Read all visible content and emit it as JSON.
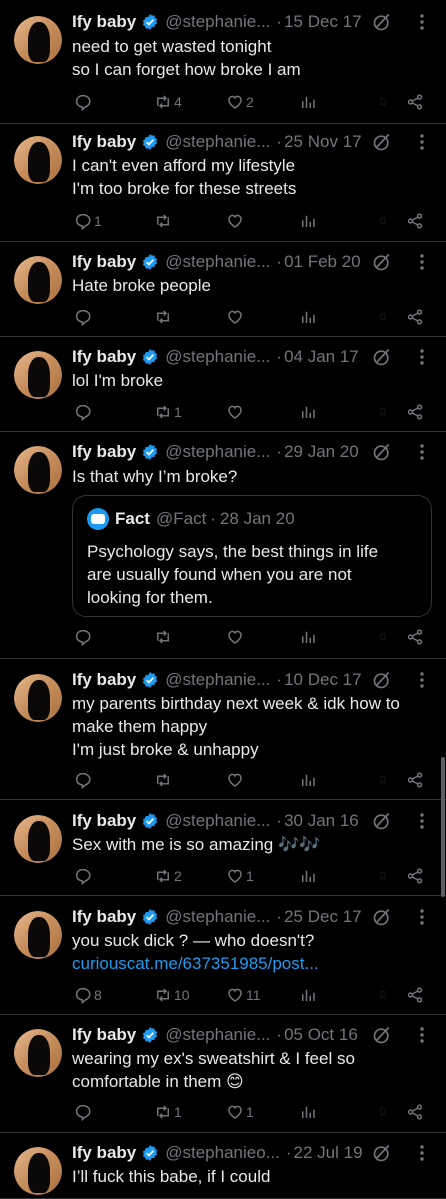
{
  "tweets": [
    {
      "name": "Ify baby",
      "handle": "@stephanie...",
      "date": "15 Dec 17",
      "lines": [
        "need to get wasted tonight",
        "so I can forget how broke I am"
      ],
      "reply_count": "",
      "retweet_count": "4",
      "like_count": "2"
    },
    {
      "name": "Ify baby",
      "handle": "@stephanie...",
      "date": "25 Nov 17",
      "lines": [
        "I can't even afford my lifestyle",
        "I'm too broke for these streets"
      ],
      "reply_count": "1",
      "retweet_count": "",
      "like_count": ""
    },
    {
      "name": "Ify baby",
      "handle": "@stephanie...",
      "date": "01 Feb 20",
      "lines": [
        "Hate broke people"
      ],
      "reply_count": "",
      "retweet_count": "",
      "like_count": ""
    },
    {
      "name": "Ify baby",
      "handle": "@stephanie...",
      "date": "04 Jan 17",
      "lines": [
        "lol I'm broke"
      ],
      "reply_count": "",
      "retweet_count": "1",
      "like_count": ""
    },
    {
      "name": "Ify baby",
      "handle": "@stephanie...",
      "date": "29 Jan 20",
      "lines": [
        "Is that why I’m broke?"
      ],
      "quote": {
        "name": "Fact",
        "handle": "@Fact",
        "date": "28 Jan 20",
        "lines": [
          "Psychology says, the best things in life",
          "are usually found when you are not",
          "looking for them."
        ]
      },
      "reply_count": "",
      "retweet_count": "",
      "like_count": ""
    },
    {
      "name": "Ify baby",
      "handle": "@stephanie...",
      "date": "10 Dec 17",
      "lines": [
        "my parents birthday next week & idk how to",
        "make them happy",
        "I'm just broke & unhappy"
      ],
      "reply_count": "",
      "retweet_count": "",
      "like_count": ""
    },
    {
      "name": "Ify baby",
      "handle": "@stephanie...",
      "date": "30 Jan 16",
      "lines": [
        "Sex with me is so amazing 🎶🎶"
      ],
      "reply_count": "",
      "retweet_count": "2",
      "like_count": "1"
    },
    {
      "name": "Ify baby",
      "handle": "@stephanie...",
      "date": "25 Dec 17",
      "lines": [
        "you suck dick ? — who doesn't?"
      ],
      "link": "curiouscat.me/637351985/post...",
      "reply_count": "8",
      "retweet_count": "10",
      "like_count": "11"
    },
    {
      "name": "Ify baby",
      "handle": "@stephanie...",
      "date": "05 Oct 16",
      "lines": [
        "wearing my ex's sweatshirt & I feel so",
        "comfortable in them 😊"
      ],
      "reply_count": "",
      "retweet_count": "1",
      "like_count": "1"
    },
    {
      "name": "Ify baby",
      "handle": "@stephanieo...",
      "date": "22 Jul 19",
      "lines": [
        "I’ll fuck this babe, if I could"
      ],
      "reply_count": "",
      "retweet_count": "",
      "like_count": ""
    }
  ],
  "icons": {
    "verified": "verified-badge-icon",
    "grok": "grok-icon",
    "more": "more-dots-icon",
    "reply": "reply-icon",
    "retweet": "retweet-icon",
    "like": "like-icon",
    "views": "views-icon",
    "bookmark": "bookmark-icon",
    "share": "share-icon"
  },
  "colors": {
    "background": "#000000",
    "text": "#e7e9ea",
    "muted": "#71767b",
    "accent": "#1d9bf0",
    "divider": "#2f3336"
  }
}
